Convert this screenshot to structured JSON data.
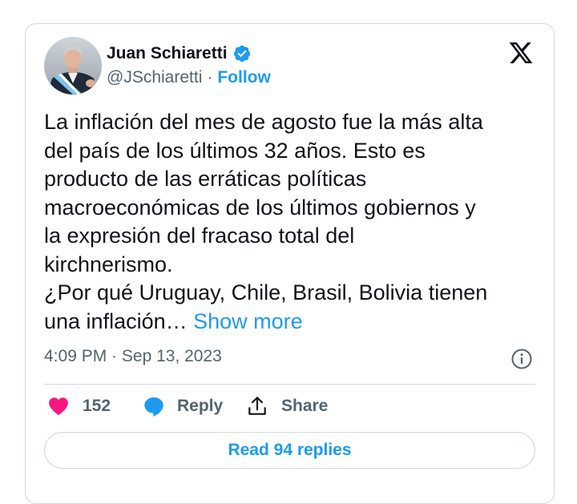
{
  "author": {
    "name": "Juan Schiaretti",
    "handle": "@JSchiaretti",
    "separator": "·",
    "follow_label": "Follow"
  },
  "icons": {
    "verified": "verified-badge-icon",
    "x_logo": "x-logo-icon",
    "info": "info-icon",
    "like": "heart-icon",
    "reply": "speech-bubble-icon",
    "share": "share-upload-icon"
  },
  "colors": {
    "accent": "#1d9bf0",
    "like": "#f91880",
    "secondary_text": "#536471",
    "border": "#cfd9de"
  },
  "tweet": {
    "text": "La inflación del mes de agosto fue la más alta\ndel país de los últimos 32 años. Esto es\nproducto de las erráticas políticas\nmacroeconómicas de los últimos gobiernos y\nla expresión del fracaso total del\nkirchnerismo.\n¿Por qué Uruguay, Chile, Brasil, Bolivia tienen\nuna inflación… ",
    "show_more": "Show more",
    "time": "4:09 PM",
    "date_separator": " · ",
    "date": "Sep 13, 2023"
  },
  "actions": {
    "like_count": "152",
    "reply_label": "Reply",
    "share_label": "Share"
  },
  "read_replies_label": "Read 94 replies"
}
